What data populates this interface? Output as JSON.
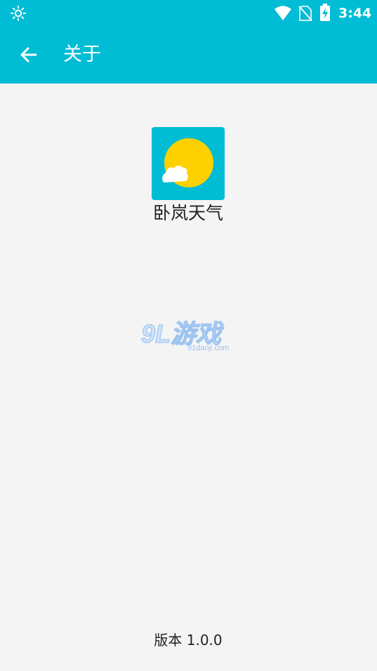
{
  "status_bar": {
    "time": "3:44",
    "icons": [
      "brightness-icon",
      "wifi-icon",
      "no-sim-icon",
      "battery-charging-icon"
    ]
  },
  "app_bar": {
    "back_icon": "arrow-left-icon",
    "title": "关于"
  },
  "about": {
    "app_icon": "sun-cloud-icon",
    "app_name": "卧岚天气",
    "version": "版本 1.0.0"
  },
  "watermark": {
    "logo_text": "9L游戏",
    "site": "91danji.com"
  },
  "colors": {
    "primary": "#00bcd4",
    "background": "#f4f4f4",
    "sun": "#fdd000",
    "text": "#222222"
  }
}
